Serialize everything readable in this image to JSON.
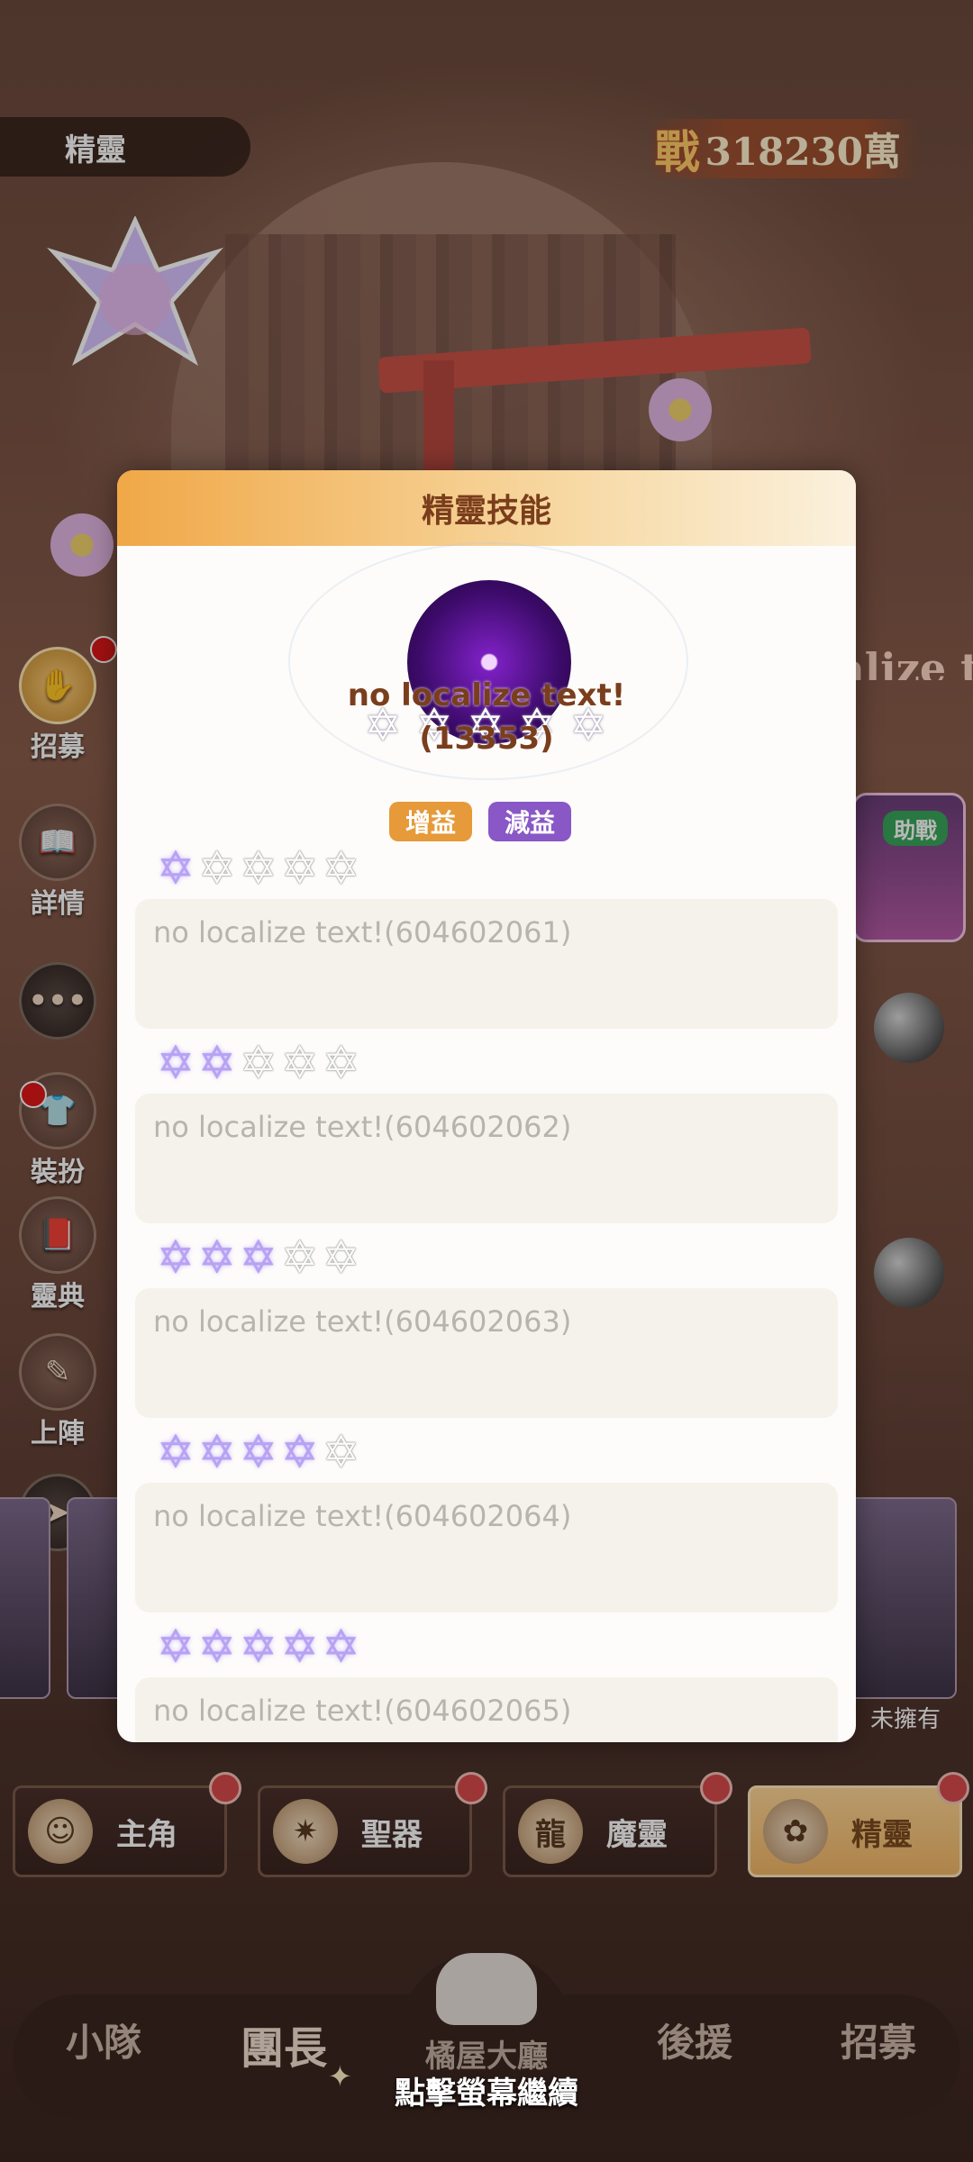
{
  "header": {
    "page_label": "精靈",
    "power_prefix": "戰",
    "power_value": "318230萬"
  },
  "logo": {
    "name": "recruit-logo"
  },
  "left_menu": {
    "items": [
      {
        "label": "招募",
        "icon": "recruit-icon"
      },
      {
        "label": "詳情",
        "icon": "book-icon"
      },
      {
        "label": "",
        "icon": "chat-icon"
      },
      {
        "label": "裝扮",
        "icon": "outfit-icon"
      },
      {
        "label": "靈典",
        "icon": "codex-icon"
      },
      {
        "label": "上陣",
        "icon": "deploy-icon"
      },
      {
        "label": "",
        "icon": "share-icon"
      }
    ]
  },
  "right_panel": {
    "banner_text": "alize t",
    "assist_tag": "助戰",
    "owned_label": "未擁有"
  },
  "dialog": {
    "title": "精靈技能",
    "skill_name": "no localize text!(13353)",
    "tags": {
      "buff": "增益",
      "debuff": "減益"
    },
    "levels": [
      {
        "stars_on": 1,
        "desc": "no localize text!(604602061)"
      },
      {
        "stars_on": 2,
        "desc": "no localize text!(604602062)"
      },
      {
        "stars_on": 3,
        "desc": "no localize text!(604602063)"
      },
      {
        "stars_on": 4,
        "desc": "no localize text!(604602064)"
      },
      {
        "stars_on": 5,
        "desc": "no localize text!(604602065)"
      }
    ],
    "stars_total": 5
  },
  "tabs": [
    {
      "label": "主角",
      "active": false
    },
    {
      "label": "聖器",
      "active": false
    },
    {
      "label": "魔靈",
      "active": false
    },
    {
      "label": "精靈",
      "active": true
    }
  ],
  "bottom_nav": {
    "items": [
      "小隊",
      "團長",
      "後援",
      "招募"
    ],
    "center_label": "橘屋大廳",
    "continue_hint": "點擊螢幕繼續"
  },
  "colors": {
    "accent": "#f0a847",
    "title": "#7a3e1c",
    "buff": "#e69a3a",
    "debuff": "#8957c6",
    "badge": "#d94a4a"
  }
}
